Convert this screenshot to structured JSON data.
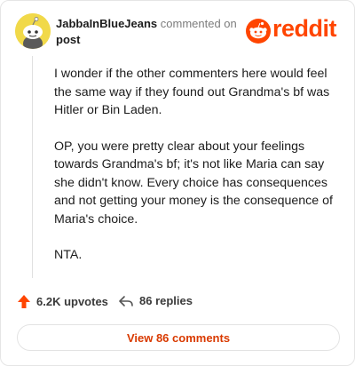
{
  "header": {
    "username": "JabbaInBlueJeans",
    "action": " commented on ",
    "target": "post",
    "brand": "reddit",
    "brand_color": "#ff4500"
  },
  "comment": {
    "paragraphs": [
      "I wonder if the other commenters here would feel the same way if they found out Grandma's bf was Hitler or Bin Laden.",
      "OP, you were pretty clear about your feelings towards Grandma's bf; it's not like Maria can say she didn't know. Every choice has consequences and not getting your money is the consequence of Maria's choice.",
      "NTA."
    ]
  },
  "actions": {
    "upvotes": "6.2K upvotes",
    "replies": "86 replies",
    "upvote_icon": "upvote-arrow-icon",
    "reply_icon": "reply-arrow-icon",
    "upvote_color": "#ff4500"
  },
  "footer": {
    "view_comments": "View 86 comments",
    "accent": "#d93a00"
  }
}
